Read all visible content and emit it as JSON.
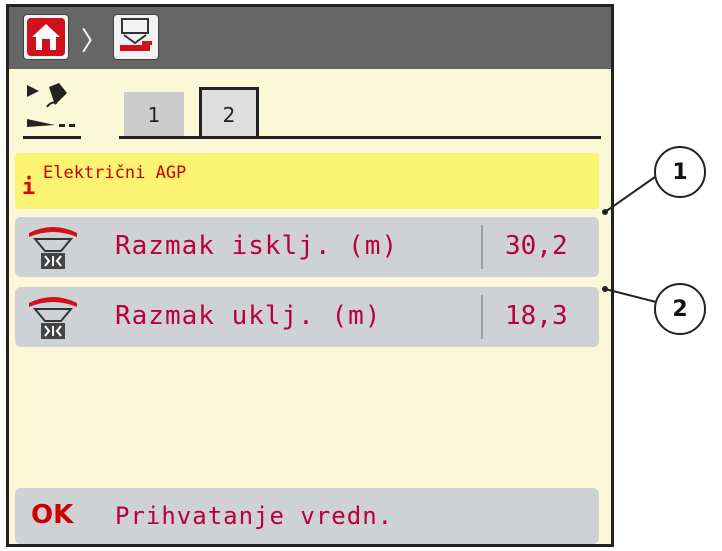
{
  "tabs": [
    {
      "label": "1",
      "active": false
    },
    {
      "label": "2",
      "active": true
    }
  ],
  "info": {
    "icon": "i",
    "text": "Električni AGP"
  },
  "rows": [
    {
      "label": "Razmak isklj. (m)",
      "value": "30,2"
    },
    {
      "label": "Razmak uklj. (m)",
      "value": "18,3"
    }
  ],
  "ok_button": {
    "icon": "OK",
    "label": "Prihvatanje vredn."
  },
  "callouts": [
    "1",
    "2"
  ],
  "icons": {
    "home": "home-icon",
    "machine": "machine-settings-icon",
    "gps": "gps-satellite-icon",
    "spreader": "spreader-distance-icon"
  },
  "colors": {
    "background": "#fbf8d8",
    "topbar": "#666666",
    "row": "#cfd2d4",
    "info": "#fbf372",
    "text_accent": "#b8003a",
    "home_red": "#d0101a"
  }
}
